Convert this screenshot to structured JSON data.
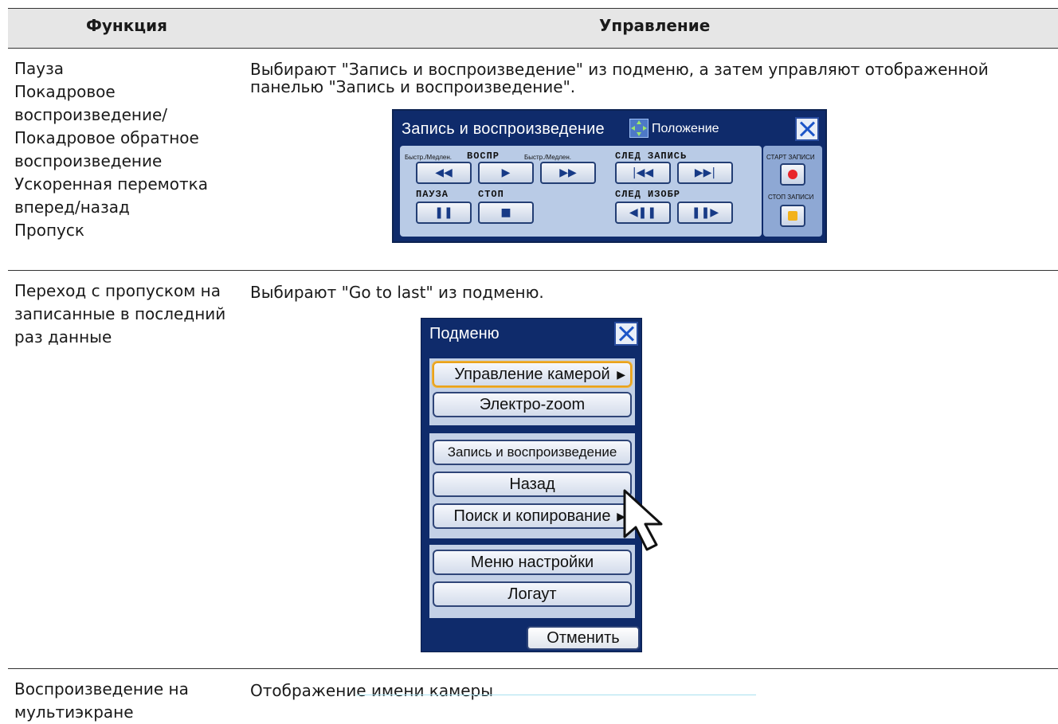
{
  "header": {
    "col1": "Функция",
    "col2": "Управление"
  },
  "rows": [
    {
      "function_lines": [
        "Пауза",
        "Покадровое",
        "воспроизведение/",
        "Покадровое обратное",
        "воспроизведение",
        "Ускоренная перемотка",
        "вперед/назад",
        "Пропуск"
      ],
      "description_lines": [
        "Выбирают \"Запись и воспроизведение\" из подменю, а затем управляют отображенной",
        "панелью \"Запись и воспроизведение\"."
      ]
    },
    {
      "function_lines": [
        "Переход с пропуском на",
        "записанные в последний",
        "раз данные"
      ],
      "description": "Выбирают \"Go to last\" из подменю."
    },
    {
      "function_lines": [
        "Воспроизведение на",
        "мультиэкране"
      ],
      "description": "Отображение имени камеры"
    }
  ],
  "playback_panel": {
    "title": "Запись и воспроизведение",
    "position_label": "Положение",
    "labels": {
      "fast_slow_1": "Быстр./Медлен.",
      "play": "ВОСПР",
      "fast_slow_2": "Быстр./Медлен.",
      "next_record": "СЛЕД ЗАПИСЬ",
      "pause": "ПАУЗА",
      "stop": "СТОП",
      "next_image": "СЛЕД ИЗОБР",
      "rec_start": "СТАРТ ЗАПИСИ",
      "rec_stop": "СТОП ЗАПИСИ"
    },
    "icons": {
      "rewind": "◀◀",
      "play": "▶",
      "fast_forward": "▶▶",
      "skip_back": "|◀◀",
      "skip_forward": "▶▶|",
      "pause": "❚❚",
      "stop": "■",
      "frame_back": "◀❚❚",
      "frame_forward": "❚❚▶"
    }
  },
  "submenu": {
    "title": "Подменю",
    "items": [
      {
        "label": "Управление камерой",
        "arrow": "▶"
      },
      {
        "label": "Электро-zoom"
      },
      {
        "label": "Запись и воспроизведение"
      },
      {
        "label": "Назад"
      },
      {
        "label": "Поиск и копирование",
        "arrow": "▶"
      },
      {
        "label": "Меню настройки"
      },
      {
        "label": "Логаут"
      }
    ],
    "cancel": "Отменить"
  }
}
